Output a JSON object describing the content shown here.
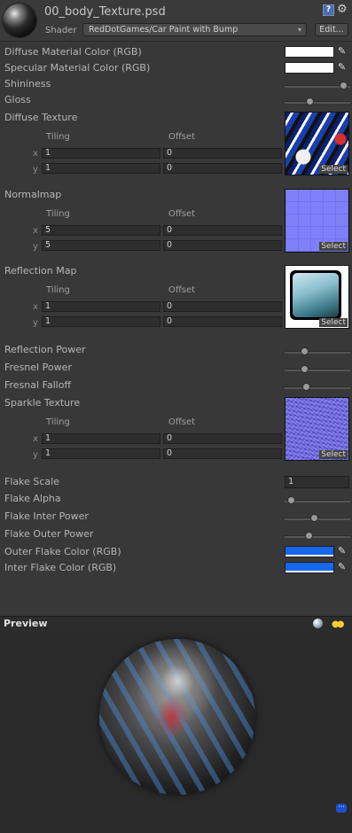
{
  "header": {
    "file_name": "00_body_Texture.psd",
    "shader_label": "Shader",
    "shader_value": "RedDotGames/Car Paint with Bump",
    "edit_label": "Edit...",
    "help_glyph": "?"
  },
  "colors": {
    "diffuse_material": "#ffffff",
    "specular_material": "#ffffff",
    "outer_flake": "#1766ee",
    "inter_flake": "#1766ee"
  },
  "properties": {
    "diffuse_material_color": "Diffuse Material Color (RGB)",
    "specular_material_color": "Specular Material Color (RGB)",
    "shininess": "Shininess",
    "gloss": "Gloss",
    "diffuse_texture": "Diffuse Texture",
    "normalmap": "Normalmap",
    "reflection_map": "Reflection Map",
    "reflection_power": "Reflection Power",
    "fresnel_power": "Fresnel Power",
    "fresnel_falloff": "Fresnal Falloff",
    "sparkle_texture": "Sparkle Texture",
    "flake_scale": "Flake Scale",
    "flake_scale_value": "1",
    "flake_alpha": "Flake Alpha",
    "flake_inter_power": "Flake Inter Power",
    "flake_outer_power": "Flake Outer Power",
    "outer_flake_color": "Outer Flake Color (RGB)",
    "inter_flake_color": "Inter Flake Color (RGB)"
  },
  "slider_levels": {
    "shininess": 0.95,
    "gloss": 0.37,
    "reflection_power": 0.28,
    "fresnel_power": 0.28,
    "fresnel_falloff": 0.3,
    "flake_alpha": 0.05,
    "flake_inter_power": 0.45,
    "flake_outer_power": 0.36
  },
  "textures": {
    "tiling_label": "Tiling",
    "offset_label": "Offset",
    "x_label": "x",
    "y_label": "y",
    "select_label": "Select",
    "diffuse": {
      "tiling_x": "1",
      "tiling_y": "1",
      "offset_x": "0",
      "offset_y": "0"
    },
    "normal": {
      "tiling_x": "5",
      "tiling_y": "5",
      "offset_x": "0",
      "offset_y": "0"
    },
    "reflection": {
      "tiling_x": "1",
      "tiling_y": "1",
      "offset_x": "0",
      "offset_y": "0"
    },
    "sparkle": {
      "tiling_x": "1",
      "tiling_y": "1",
      "offset_x": "0",
      "offset_y": "0"
    }
  },
  "preview": {
    "title": "Preview"
  },
  "icons": {
    "help": "help-icon",
    "settings": "gear-icon",
    "color_picker": "eyedropper-icon",
    "preview_sphere": "sphere-icon",
    "preview_lights": "lights-icon"
  }
}
